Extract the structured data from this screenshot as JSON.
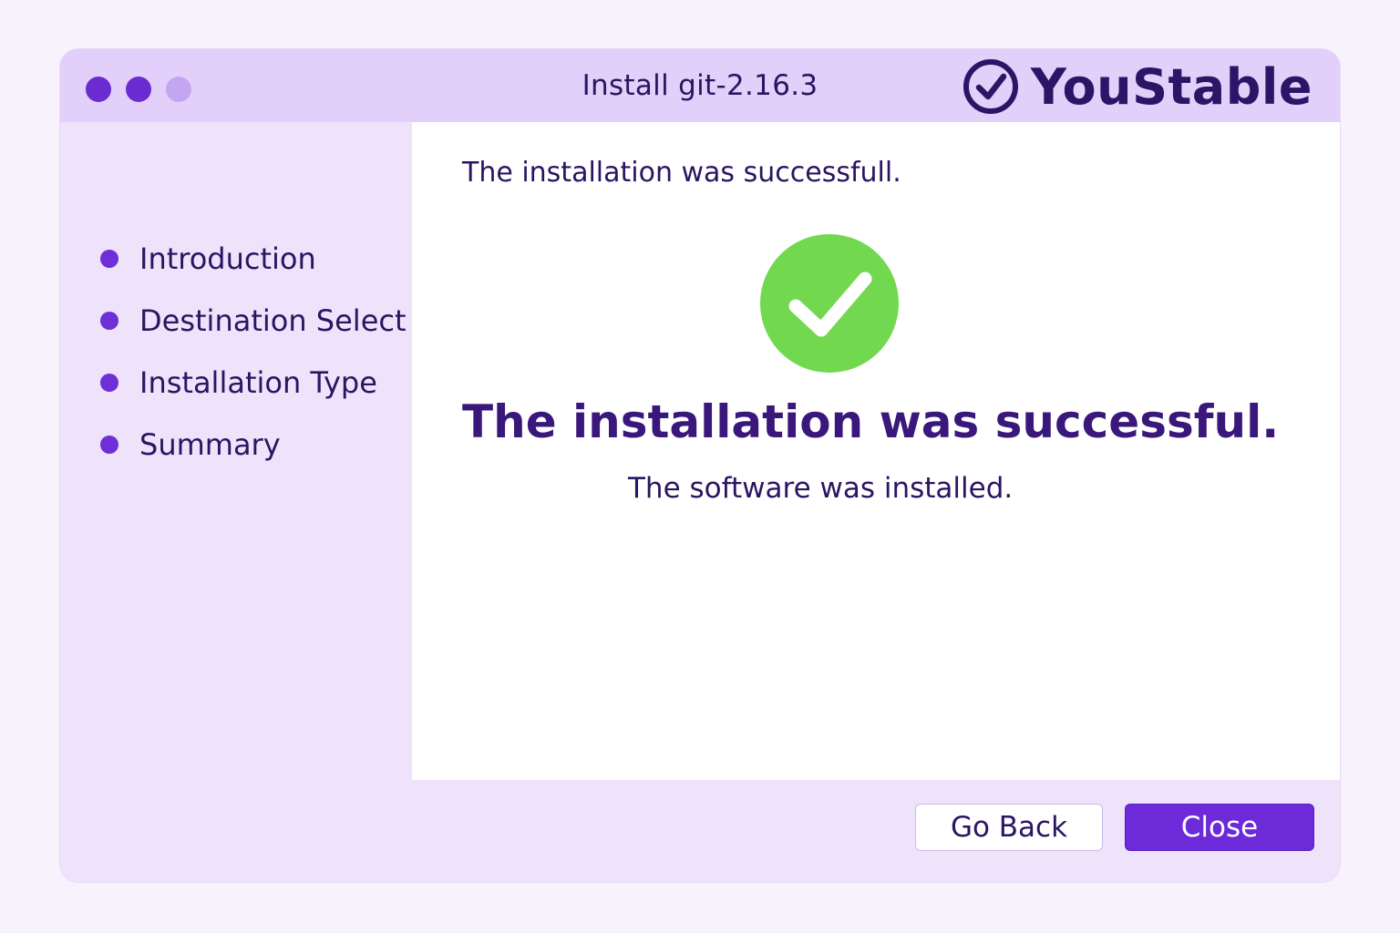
{
  "window": {
    "title": "Install git-2.16.3",
    "brand_name": "YouStable",
    "brand_icon": "check-circle-icon"
  },
  "sidebar": {
    "steps": [
      {
        "label": "Introduction"
      },
      {
        "label": "Destination Select"
      },
      {
        "label": "Installation Type"
      },
      {
        "label": "Summary"
      }
    ]
  },
  "main": {
    "top_message": "The installation was successfull.",
    "status_icon": "success-check-icon",
    "headline": "The installation was successful.",
    "subline": "The software was installed."
  },
  "footer": {
    "back_label": "Go Back",
    "close_label": "Close"
  },
  "colors": {
    "accent": "#6d2ad8",
    "success": "#71d84f",
    "titlebar": "#e2cffa",
    "text": "#2a1561"
  }
}
